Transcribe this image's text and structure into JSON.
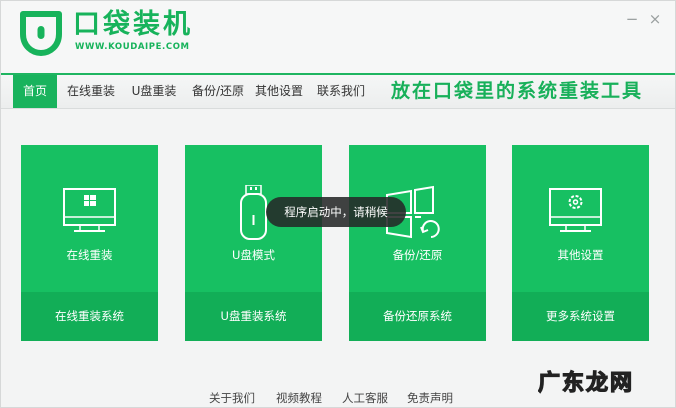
{
  "brand": {
    "title": "口袋装机",
    "url": "WWW.KOUDAIPE.COM",
    "color": "#17b35b"
  },
  "window_controls": {
    "minimize_glyph": "−",
    "close_glyph": "×"
  },
  "nav": {
    "items": [
      {
        "label": "首页",
        "active": true
      },
      {
        "label": "在线重装",
        "active": false
      },
      {
        "label": "U盘重装",
        "active": false
      },
      {
        "label": "备份/还原",
        "active": false
      },
      {
        "label": "其他设置",
        "active": false
      },
      {
        "label": "联系我们",
        "active": false
      }
    ],
    "slogan": "放在口袋里的系统重装工具"
  },
  "cards": [
    {
      "icon": "monitor-windows-icon",
      "label": "在线重装",
      "footer": "在线重装系统"
    },
    {
      "icon": "usb-drive-icon",
      "label": "U盘模式",
      "footer": "U盘重装系统"
    },
    {
      "icon": "windows-restore-icon",
      "label": "备份/还原",
      "footer": "备份还原系统"
    },
    {
      "icon": "monitor-gear-icon",
      "label": "其他设置",
      "footer": "更多系统设置"
    }
  ],
  "toast": {
    "text": "程序启动中，请稍候"
  },
  "footer_links": [
    "关于我们",
    "视频教程",
    "人工客服",
    "免责声明"
  ],
  "watermark": {
    "text": "广东龙网"
  },
  "colors": {
    "accent": "#17c062",
    "accent_dark": "#12ae57",
    "background": "#f3f4f4"
  }
}
